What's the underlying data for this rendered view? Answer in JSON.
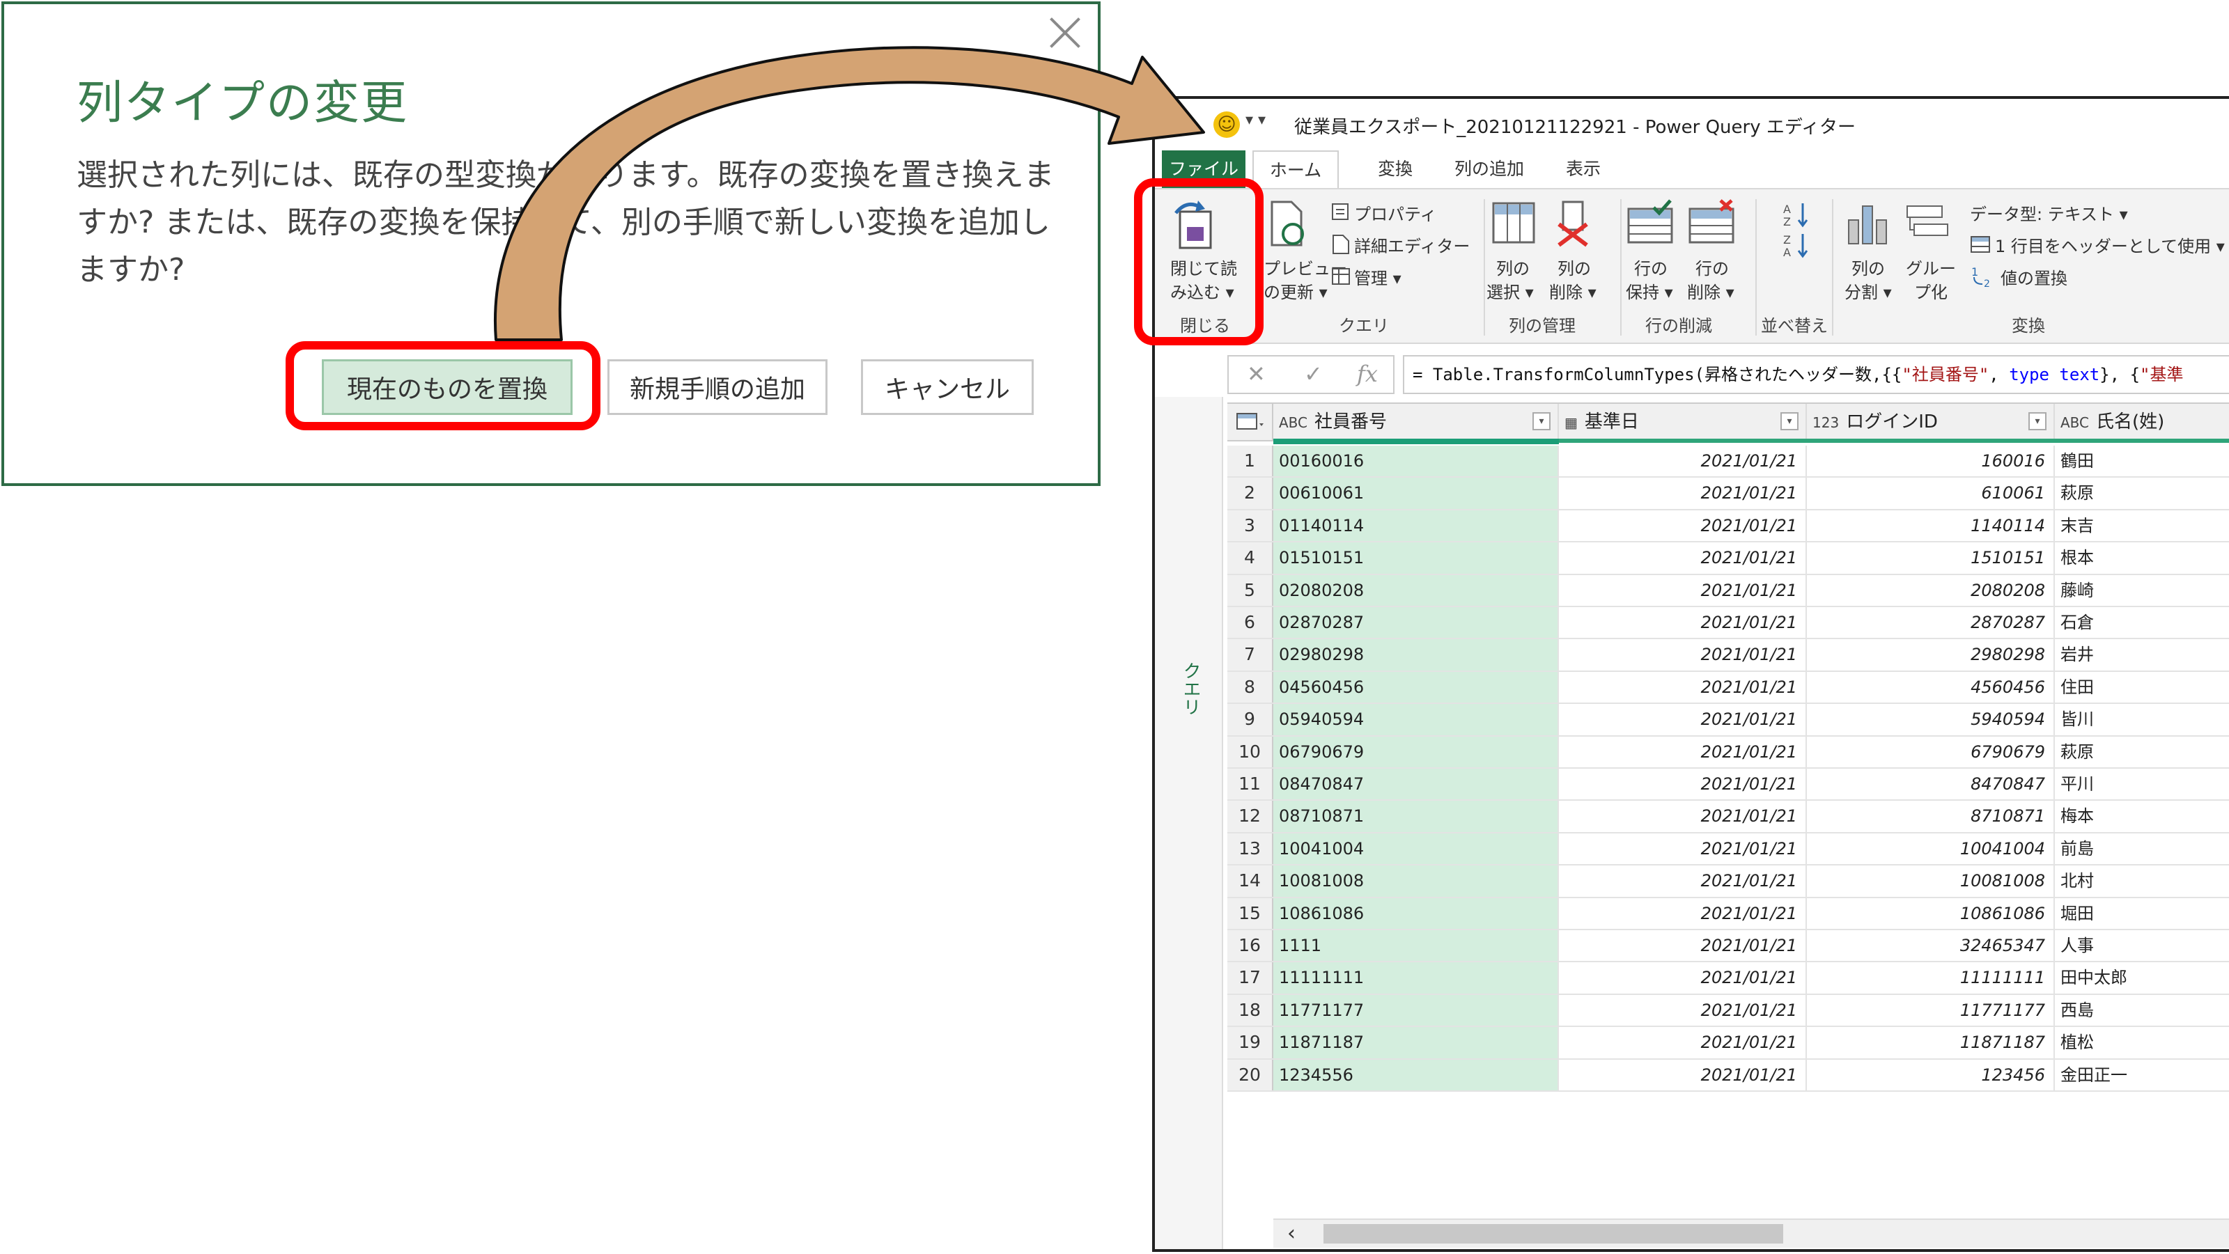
{
  "dialog": {
    "title": "列タイプの変更",
    "message": "選択された列には、既存の型変換があります。既存の変換を置き換えますか? または、既存の変換を保持して、別の手順で新しい変換を追加しますか?",
    "buttons": {
      "replace": "現在のものを置換",
      "add_step": "新規手順の追加",
      "cancel": "キャンセル"
    },
    "close_icon": "close-icon"
  },
  "editor": {
    "window_title": "従業員エクスポート_20210121122921 - Power Query エディター",
    "tabs": [
      "ファイル",
      "ホーム",
      "変換",
      "列の追加",
      "表示"
    ],
    "ribbon": {
      "close_load": [
        "閉じて読",
        "み込む ▾"
      ],
      "close_group": "閉じる",
      "refresh_preview": [
        "プレビュー",
        "の更新 ▾"
      ],
      "properties": "プロパティ",
      "advanced_editor": "詳細エディター",
      "manage": "管理 ▾",
      "query_group": "クエリ",
      "choose_columns": [
        "列の",
        "選択 ▾"
      ],
      "remove_columns": [
        "列の",
        "削除 ▾"
      ],
      "manage_columns_group": "列の管理",
      "keep_rows": [
        "行の",
        "保持 ▾"
      ],
      "remove_rows": [
        "行の",
        "削除 ▾"
      ],
      "reduce_rows_group": "行の削減",
      "sort_group": "並べ替え",
      "split_column": [
        "列の",
        "分割 ▾"
      ],
      "group_by": [
        "グルー",
        "プ化"
      ],
      "data_type": "データ型: テキスト ▾",
      "use_first_row": "1 行目をヘッダーとして使用 ▾",
      "replace_values": "値の置換",
      "transform_group": "変換"
    },
    "side_label": "クエリ",
    "formula": {
      "prefix": "= Table.TransformColumnTypes(昇格されたヘッダー数,{{",
      "s1": "\"社員番号\"",
      "comma": ", ",
      "kw": "type text",
      "mid": "}, {",
      "s2": "\"基準"
    },
    "columns": [
      {
        "type": "ABC",
        "name": "社員番号"
      },
      {
        "type": "date",
        "name": "基準日"
      },
      {
        "type": "123",
        "name": "ログインID"
      },
      {
        "type": "ABC",
        "name": "氏名(姓)"
      }
    ],
    "rows": [
      [
        "1",
        "00160016",
        "2021/01/21",
        "160016",
        "鶴田"
      ],
      [
        "2",
        "00610061",
        "2021/01/21",
        "610061",
        "萩原"
      ],
      [
        "3",
        "01140114",
        "2021/01/21",
        "1140114",
        "末吉"
      ],
      [
        "4",
        "01510151",
        "2021/01/21",
        "1510151",
        "根本"
      ],
      [
        "5",
        "02080208",
        "2021/01/21",
        "2080208",
        "藤崎"
      ],
      [
        "6",
        "02870287",
        "2021/01/21",
        "2870287",
        "石倉"
      ],
      [
        "7",
        "02980298",
        "2021/01/21",
        "2980298",
        "岩井"
      ],
      [
        "8",
        "04560456",
        "2021/01/21",
        "4560456",
        "住田"
      ],
      [
        "9",
        "05940594",
        "2021/01/21",
        "5940594",
        "皆川"
      ],
      [
        "10",
        "06790679",
        "2021/01/21",
        "6790679",
        "萩原"
      ],
      [
        "11",
        "08470847",
        "2021/01/21",
        "8470847",
        "平川"
      ],
      [
        "12",
        "08710871",
        "2021/01/21",
        "8710871",
        "梅本"
      ],
      [
        "13",
        "10041004",
        "2021/01/21",
        "10041004",
        "前島"
      ],
      [
        "14",
        "10081008",
        "2021/01/21",
        "10081008",
        "北村"
      ],
      [
        "15",
        "10861086",
        "2021/01/21",
        "10861086",
        "堀田"
      ],
      [
        "16",
        "1111",
        "2021/01/21",
        "32465347",
        "人事"
      ],
      [
        "17",
        "11111111",
        "2021/01/21",
        "11111111",
        "田中太郎"
      ],
      [
        "18",
        "11771177",
        "2021/01/21",
        "11771177",
        "西島"
      ],
      [
        "19",
        "11871187",
        "2021/01/21",
        "11871187",
        "植松"
      ],
      [
        "20",
        "1234556",
        "2021/01/21",
        "123456",
        "金田正一"
      ]
    ],
    "colors": {
      "accent_green": "#217346",
      "selected_column": "#d4eede",
      "highlight": "#ff0000",
      "arrow_fill": "#d4a373"
    }
  }
}
